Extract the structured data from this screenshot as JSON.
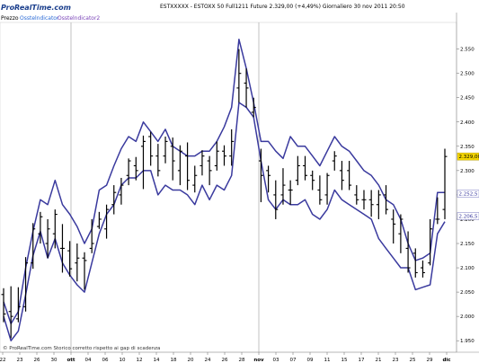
{
  "header": {
    "logo": "ProRealTime.com",
    "title": "ESTXXXXX - ESTOXX 50 Full1211 Future   2.329,00 (+4,49%)    Giornaliero  30 nov 2011 20:50",
    "indicators_prefix": "Prezzo",
    "indicator_1": "Osstelndicator",
    "indicator_2": "Osstelndicator2"
  },
  "footer": {
    "note": "© ProRealTime.com  Storico corretto rispetto ai gap di scadenza"
  },
  "colors": {
    "background": "#ffffff",
    "envelope": "#3a3a9e",
    "bars": "#000000",
    "separator": "#9a9a9a"
  },
  "chart_data": {
    "type": "bar",
    "y_ticks": [
      "2.550",
      "2.500",
      "2.450",
      "2.400",
      "2.350",
      "2.300",
      "2.250",
      "2.200",
      "2.150",
      "2.100",
      "2.050",
      "2.000",
      "1.950"
    ],
    "ylim": [
      1930,
      2590
    ],
    "price_labels": [
      {
        "text": "2.329,00",
        "value": 2329,
        "style": "current"
      },
      {
        "text": "2.252,5",
        "value": 2252.5,
        "style": "upper"
      },
      {
        "text": "2.206,5",
        "value": 2206.5,
        "style": "lower"
      }
    ],
    "x_ticks": [
      "22",
      "23",
      "26",
      "30",
      "ott",
      "04",
      "06",
      "10",
      "12",
      "14",
      "18",
      "20",
      "24",
      "26",
      "28",
      "nov",
      "03",
      "07",
      "09",
      "11",
      "15",
      "17",
      "21",
      "23",
      "25",
      "29",
      "dic"
    ],
    "month_separators": [
      "ott",
      "nov",
      "dic"
    ],
    "ohlc": [
      {
        "open": 2045,
        "high": 2058,
        "low": 1988,
        "close": 2005
      },
      {
        "open": 2010,
        "high": 2062,
        "low": 1955,
        "close": 2000
      },
      {
        "open": 1995,
        "high": 2060,
        "low": 1988,
        "close": 2020
      },
      {
        "open": 2020,
        "high": 2122,
        "low": 2010,
        "close": 2110
      },
      {
        "open": 2110,
        "high": 2192,
        "low": 2098,
        "close": 2180
      },
      {
        "open": 2170,
        "high": 2215,
        "low": 2150,
        "close": 2205
      },
      {
        "open": 2150,
        "high": 2200,
        "low": 2120,
        "close": 2180
      },
      {
        "open": 2170,
        "high": 2220,
        "low": 2140,
        "close": 2210
      },
      {
        "open": 2140,
        "high": 2190,
        "low": 2090,
        "close": 2140
      },
      {
        "open": 2135,
        "high": 2155,
        "low": 2082,
        "close": 2098
      },
      {
        "open": 2110,
        "high": 2150,
        "low": 2072,
        "close": 2120
      },
      {
        "open": 2120,
        "high": 2132,
        "low": 2055,
        "close": 2115
      },
      {
        "open": 2140,
        "high": 2200,
        "low": 2130,
        "close": 2150
      },
      {
        "open": 2185,
        "high": 2215,
        "low": 2180,
        "close": 2200
      },
      {
        "open": 2180,
        "high": 2230,
        "low": 2160,
        "close": 2220
      },
      {
        "open": 2230,
        "high": 2270,
        "low": 2210,
        "close": 2255
      },
      {
        "open": 2250,
        "high": 2285,
        "low": 2230,
        "close": 2270
      },
      {
        "open": 2290,
        "high": 2325,
        "low": 2270,
        "close": 2320
      },
      {
        "open": 2310,
        "high": 2328,
        "low": 2280,
        "close": 2300
      },
      {
        "open": 2350,
        "high": 2372,
        "low": 2262,
        "close": 2360
      },
      {
        "open": 2370,
        "high": 2380,
        "low": 2310,
        "close": 2330
      },
      {
        "open": 2330,
        "high": 2355,
        "low": 2288,
        "close": 2300
      },
      {
        "open": 2330,
        "high": 2370,
        "low": 2315,
        "close": 2360
      },
      {
        "open": 2350,
        "high": 2368,
        "low": 2280,
        "close": 2320
      },
      {
        "open": 2300,
        "high": 2352,
        "low": 2270,
        "close": 2340
      },
      {
        "open": 2330,
        "high": 2358,
        "low": 2260,
        "close": 2280
      },
      {
        "open": 2270,
        "high": 2310,
        "low": 2255,
        "close": 2290
      },
      {
        "open": 2310,
        "high": 2342,
        "low": 2290,
        "close": 2330
      },
      {
        "open": 2320,
        "high": 2330,
        "low": 2270,
        "close": 2300
      },
      {
        "open": 2310,
        "high": 2360,
        "low": 2300,
        "close": 2340
      },
      {
        "open": 2340,
        "high": 2352,
        "low": 2310,
        "close": 2330
      },
      {
        "open": 2330,
        "high": 2385,
        "low": 2310,
        "close": 2360
      },
      {
        "open": 2470,
        "high": 2550,
        "low": 2440,
        "close": 2500
      },
      {
        "open": 2480,
        "high": 2510,
        "low": 2430,
        "close": 2470
      },
      {
        "open": 2420,
        "high": 2450,
        "low": 2410,
        "close": 2430
      },
      {
        "open": 2320,
        "high": 2345,
        "low": 2235,
        "close": 2290
      },
      {
        "open": 2300,
        "high": 2310,
        "low": 2255,
        "close": 2290
      },
      {
        "open": 2250,
        "high": 2280,
        "low": 2200,
        "close": 2220
      },
      {
        "open": 2250,
        "high": 2305,
        "low": 2230,
        "close": 2270
      },
      {
        "open": 2260,
        "high": 2280,
        "low": 2230,
        "close": 2260
      },
      {
        "open": 2280,
        "high": 2330,
        "low": 2270,
        "close": 2310
      },
      {
        "open": 2310,
        "high": 2330,
        "low": 2280,
        "close": 2290
      },
      {
        "open": 2290,
        "high": 2300,
        "low": 2260,
        "close": 2280
      },
      {
        "open": 2260,
        "high": 2290,
        "low": 2230,
        "close": 2240
      },
      {
        "open": 2250,
        "high": 2295,
        "low": 2230,
        "close": 2290
      },
      {
        "open": 2320,
        "high": 2340,
        "low": 2300,
        "close": 2330
      },
      {
        "open": 2300,
        "high": 2320,
        "low": 2260,
        "close": 2280
      },
      {
        "open": 2300,
        "high": 2320,
        "low": 2260,
        "close": 2270
      },
      {
        "open": 2250,
        "high": 2270,
        "low": 2230,
        "close": 2240
      },
      {
        "open": 2240,
        "high": 2260,
        "low": 2220,
        "close": 2240
      },
      {
        "open": 2240,
        "high": 2260,
        "low": 2205,
        "close": 2230
      },
      {
        "open": 2230,
        "high": 2260,
        "low": 2200,
        "close": 2250
      },
      {
        "open": 2250,
        "high": 2270,
        "low": 2210,
        "close": 2220
      },
      {
        "open": 2200,
        "high": 2220,
        "low": 2150,
        "close": 2190
      },
      {
        "open": 2170,
        "high": 2210,
        "low": 2130,
        "close": 2200
      },
      {
        "open": 2140,
        "high": 2175,
        "low": 2090,
        "close": 2100
      },
      {
        "open": 2130,
        "high": 2140,
        "low": 2080,
        "close": 2090
      },
      {
        "open": 2100,
        "high": 2115,
        "low": 2080,
        "close": 2090
      },
      {
        "open": 2110,
        "high": 2200,
        "low": 2105,
        "close": 2180
      },
      {
        "open": 2200,
        "high": 2245,
        "low": 2190,
        "close": 2200
      },
      {
        "open": 2220,
        "high": 2345,
        "low": 2200,
        "close": 2329
      }
    ],
    "upper_band": [
      2030,
      1985,
      2010,
      2100,
      2175,
      2240,
      2230,
      2280,
      2230,
      2210,
      2185,
      2150,
      2180,
      2260,
      2270,
      2310,
      2345,
      2370,
      2360,
      2400,
      2380,
      2360,
      2385,
      2350,
      2340,
      2330,
      2330,
      2340,
      2340,
      2360,
      2390,
      2430,
      2570,
      2510,
      2440,
      2360,
      2360,
      2340,
      2325,
      2370,
      2350,
      2350,
      2330,
      2310,
      2340,
      2370,
      2350,
      2340,
      2320,
      2300,
      2290,
      2270,
      2240,
      2230,
      2200,
      2150,
      2115,
      2120,
      2130,
      2255,
      2255
    ],
    "lower_band": [
      2000,
      1950,
      1970,
      2045,
      2125,
      2175,
      2120,
      2160,
      2110,
      2085,
      2065,
      2050,
      2110,
      2170,
      2210,
      2230,
      2270,
      2285,
      2285,
      2300,
      2300,
      2250,
      2270,
      2260,
      2260,
      2250,
      2230,
      2270,
      2240,
      2270,
      2260,
      2290,
      2440,
      2430,
      2410,
      2320,
      2240,
      2220,
      2240,
      2230,
      2230,
      2240,
      2210,
      2200,
      2220,
      2260,
      2240,
      2230,
      2220,
      2210,
      2200,
      2160,
      2140,
      2120,
      2100,
      2100,
      2055,
      2060,
      2065,
      2170,
      2195
    ]
  }
}
